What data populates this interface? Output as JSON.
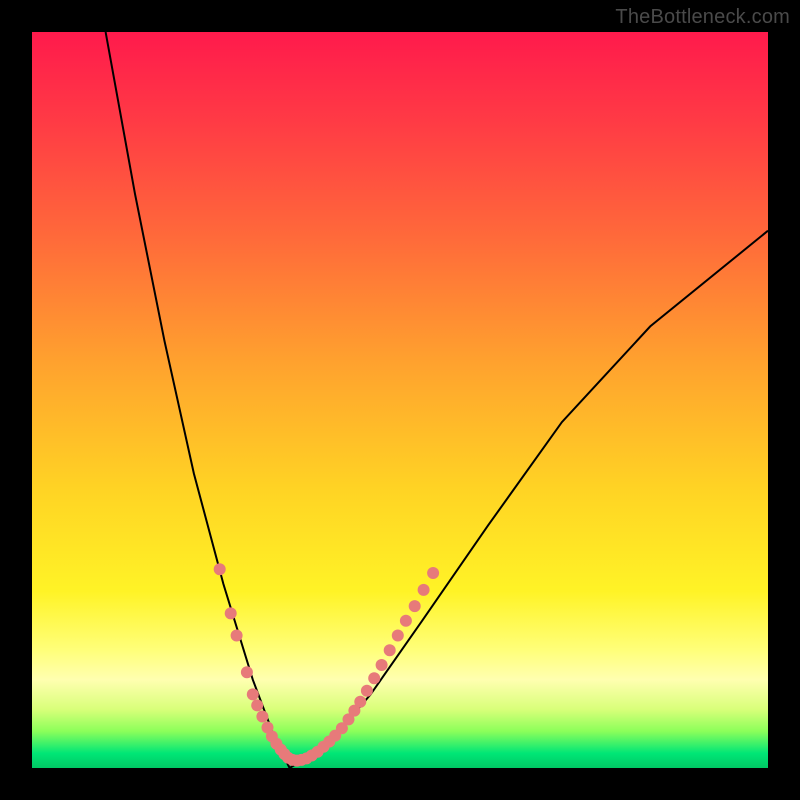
{
  "watermark": "TheBottleneck.com",
  "colors": {
    "frame": "#000000",
    "gradient_top": "#ff1a4c",
    "gradient_mid": "#ffd324",
    "gradient_bottom": "#00c864",
    "curve": "#000000",
    "points": "#e77a7a"
  },
  "chart_data": {
    "type": "line",
    "title": "",
    "xlabel": "",
    "ylabel": "",
    "xlim": [
      0,
      100
    ],
    "ylim": [
      0,
      100
    ],
    "note": "V-shaped bottleneck curve; y≈0 (green) near x≈35, rising sharply toward red at both ends. Left branch steeper than right. Pink dots mark sampled hardware along the curve clustered near the minimum.",
    "left_branch": [
      {
        "x": 10,
        "y": 100
      },
      {
        "x": 14,
        "y": 78
      },
      {
        "x": 18,
        "y": 58
      },
      {
        "x": 22,
        "y": 40
      },
      {
        "x": 26,
        "y": 25
      },
      {
        "x": 30,
        "y": 12
      },
      {
        "x": 33,
        "y": 4
      },
      {
        "x": 35,
        "y": 0
      }
    ],
    "right_branch": [
      {
        "x": 35,
        "y": 0
      },
      {
        "x": 40,
        "y": 3
      },
      {
        "x": 46,
        "y": 10
      },
      {
        "x": 53,
        "y": 20
      },
      {
        "x": 62,
        "y": 33
      },
      {
        "x": 72,
        "y": 47
      },
      {
        "x": 84,
        "y": 60
      },
      {
        "x": 100,
        "y": 73
      }
    ],
    "points": [
      {
        "x": 25.5,
        "y": 27
      },
      {
        "x": 27.0,
        "y": 21
      },
      {
        "x": 27.8,
        "y": 18
      },
      {
        "x": 29.2,
        "y": 13
      },
      {
        "x": 30.0,
        "y": 10
      },
      {
        "x": 30.6,
        "y": 8.5
      },
      {
        "x": 31.3,
        "y": 7
      },
      {
        "x": 32.0,
        "y": 5.5
      },
      {
        "x": 32.6,
        "y": 4.3
      },
      {
        "x": 33.2,
        "y": 3.3
      },
      {
        "x": 33.8,
        "y": 2.5
      },
      {
        "x": 34.3,
        "y": 1.9
      },
      {
        "x": 34.8,
        "y": 1.4
      },
      {
        "x": 35.4,
        "y": 1.1
      },
      {
        "x": 36.0,
        "y": 1.0
      },
      {
        "x": 36.6,
        "y": 1.1
      },
      {
        "x": 37.3,
        "y": 1.3
      },
      {
        "x": 38.0,
        "y": 1.7
      },
      {
        "x": 38.8,
        "y": 2.2
      },
      {
        "x": 39.6,
        "y": 2.9
      },
      {
        "x": 40.4,
        "y": 3.6
      },
      {
        "x": 41.2,
        "y": 4.4
      },
      {
        "x": 42.1,
        "y": 5.4
      },
      {
        "x": 43.0,
        "y": 6.6
      },
      {
        "x": 43.8,
        "y": 7.8
      },
      {
        "x": 44.6,
        "y": 9.0
      },
      {
        "x": 45.5,
        "y": 10.5
      },
      {
        "x": 46.5,
        "y": 12.2
      },
      {
        "x": 47.5,
        "y": 14.0
      },
      {
        "x": 48.6,
        "y": 16.0
      },
      {
        "x": 49.7,
        "y": 18.0
      },
      {
        "x": 50.8,
        "y": 20.0
      },
      {
        "x": 52.0,
        "y": 22.0
      },
      {
        "x": 53.2,
        "y": 24.2
      },
      {
        "x": 54.5,
        "y": 26.5
      }
    ]
  }
}
